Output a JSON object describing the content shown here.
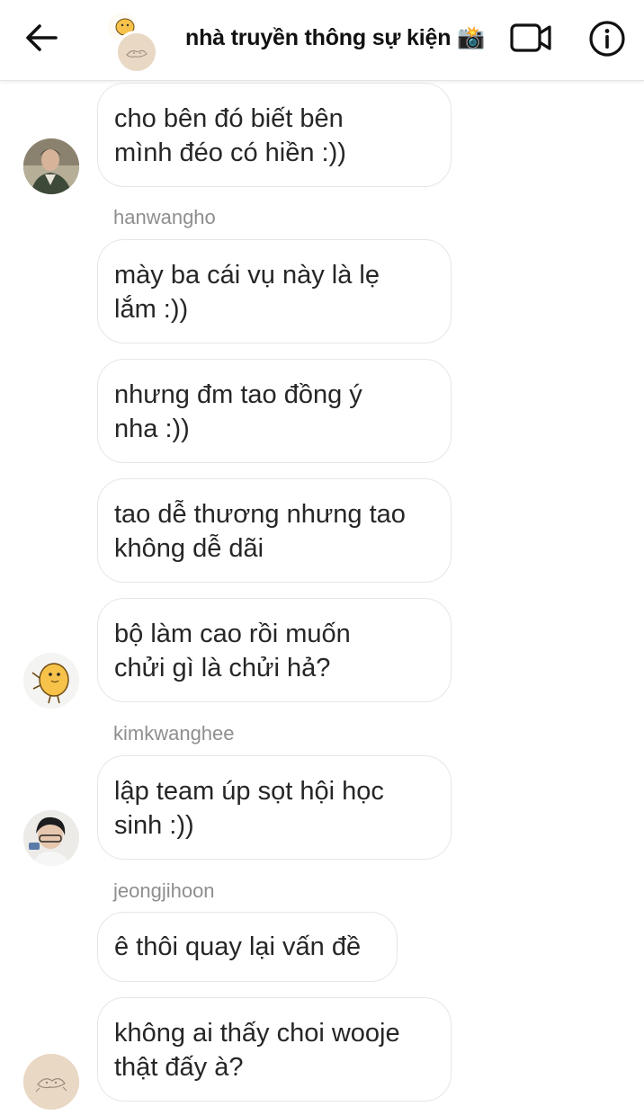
{
  "header": {
    "title": "nhà truyền thông sự kiện 📸",
    "back_icon": "arrow-left-icon",
    "video_icon": "video-camera-icon",
    "info_icon": "info-icon"
  },
  "colors": {
    "bubble_border": "#e6e6e6",
    "sender_text": "#8e8e8e",
    "text": "#262626"
  },
  "messages": [
    {
      "lines": [
        "cho bên đó biết bên",
        "mình đéo có hiền :))"
      ]
    },
    {
      "sender": "hanwangho"
    },
    {
      "lines": [
        "mày ba cái vụ này là lẹ",
        "lắm :))"
      ]
    },
    {
      "lines": [
        "nhưng đm tao đồng ý",
        "nha :))"
      ]
    },
    {
      "lines": [
        "tao dễ thương nhưng tao",
        "không dễ dãi"
      ]
    },
    {
      "lines": [
        "bộ làm cao rồi muốn",
        "chửi gì là chửi hả?"
      ]
    },
    {
      "sender": "kimkwanghee"
    },
    {
      "lines": [
        "lập team úp sọt hội học",
        "sinh :))"
      ]
    },
    {
      "sender": "jeongjihoon"
    },
    {
      "lines": [
        "ê thôi quay lại vấn đề"
      ]
    },
    {
      "lines": [
        "không ai thấy choi wooje",
        "thật đấy à?"
      ]
    }
  ]
}
